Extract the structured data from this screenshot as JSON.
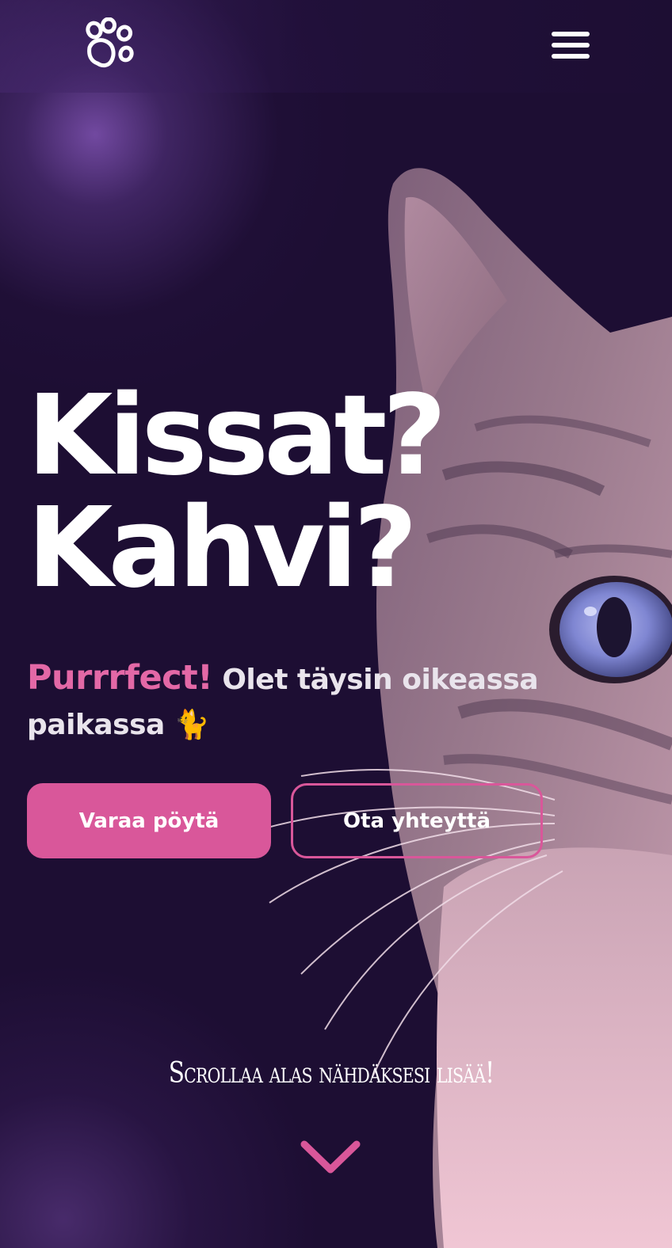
{
  "header": {
    "logo_icon": "paw-print-icon",
    "menu_icon": "hamburger-menu-icon"
  },
  "hero": {
    "title_line1": "Kissat?",
    "title_line2": "Kahvi?",
    "tagline_accent": "Purrrfect!",
    "tagline_text": "Olet täysin oikeassa paikassa 🐈"
  },
  "buttons": {
    "primary_label": "Varaa pöytä",
    "secondary_label": "Ota yhteyttä"
  },
  "scroll": {
    "hint": "Scrollaa alas nähdäksesi lisää!",
    "icon": "chevron-down-icon"
  },
  "colors": {
    "background": "#1d0e33",
    "accent": "#d9579a",
    "accent_text": "#e368a6",
    "text": "#ffffff"
  }
}
